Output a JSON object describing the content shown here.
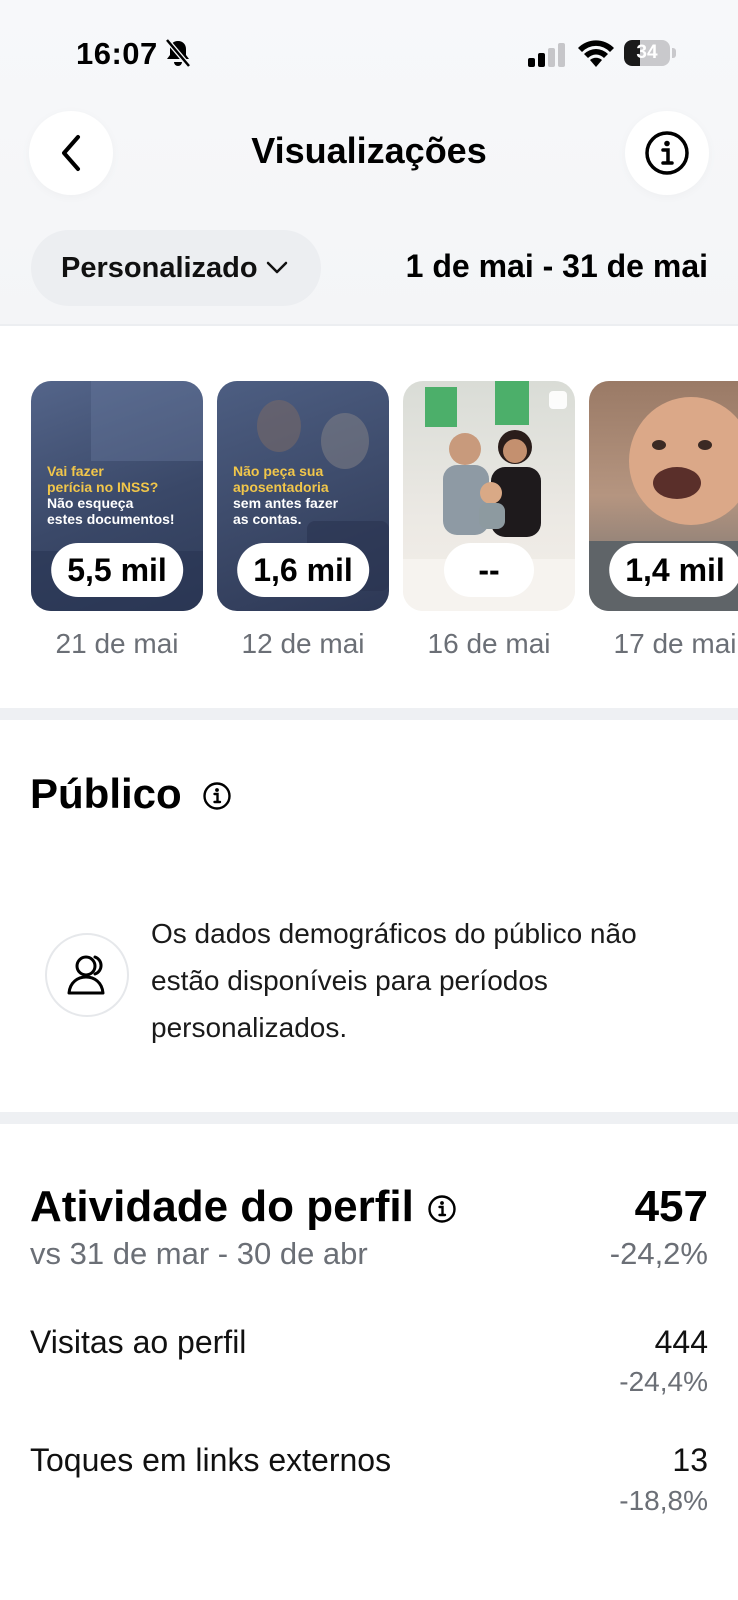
{
  "status": {
    "time": "16:07",
    "battery": "34",
    "battery_level": 0.34
  },
  "header": {
    "title": "Visualizações"
  },
  "filter": {
    "period_label": "Personalizado",
    "date_range": "1 de mai - 31 de mai"
  },
  "posts": [
    {
      "views": "5,5 mil",
      "date": "21 de mai",
      "text_lines": [
        "Vai fazer",
        "perícia no INSS?",
        "Não esqueça",
        "estes documentos!"
      ]
    },
    {
      "views": "1,6 mil",
      "date": "12 de mai",
      "text_lines": [
        "Não peça sua",
        "aposentadoria",
        "sem antes fazer",
        "as contas."
      ]
    },
    {
      "views": "--",
      "date": "16 de mai"
    },
    {
      "views": "1,4 mil",
      "date": "17 de mai"
    }
  ],
  "audience": {
    "title": "Público",
    "message": "Os dados demográficos do público não estão disponíveis para períodos personalizados."
  },
  "activity": {
    "title": "Atividade do perfil",
    "total": "457",
    "compare_period": "vs 31 de mar - 30 de abr",
    "change": "-24,2%",
    "rows": [
      {
        "label": "Visitas ao perfil",
        "value": "444",
        "change": "-24,4%"
      },
      {
        "label": "Toques em links externos",
        "value": "13",
        "change": "-18,8%"
      }
    ]
  },
  "colors": {
    "background": "#ffffff",
    "header_bg": "#f5f6f8",
    "pill_bg": "#eceef1",
    "muted_text": "#6b6f76",
    "separator": "#eef0f3"
  }
}
